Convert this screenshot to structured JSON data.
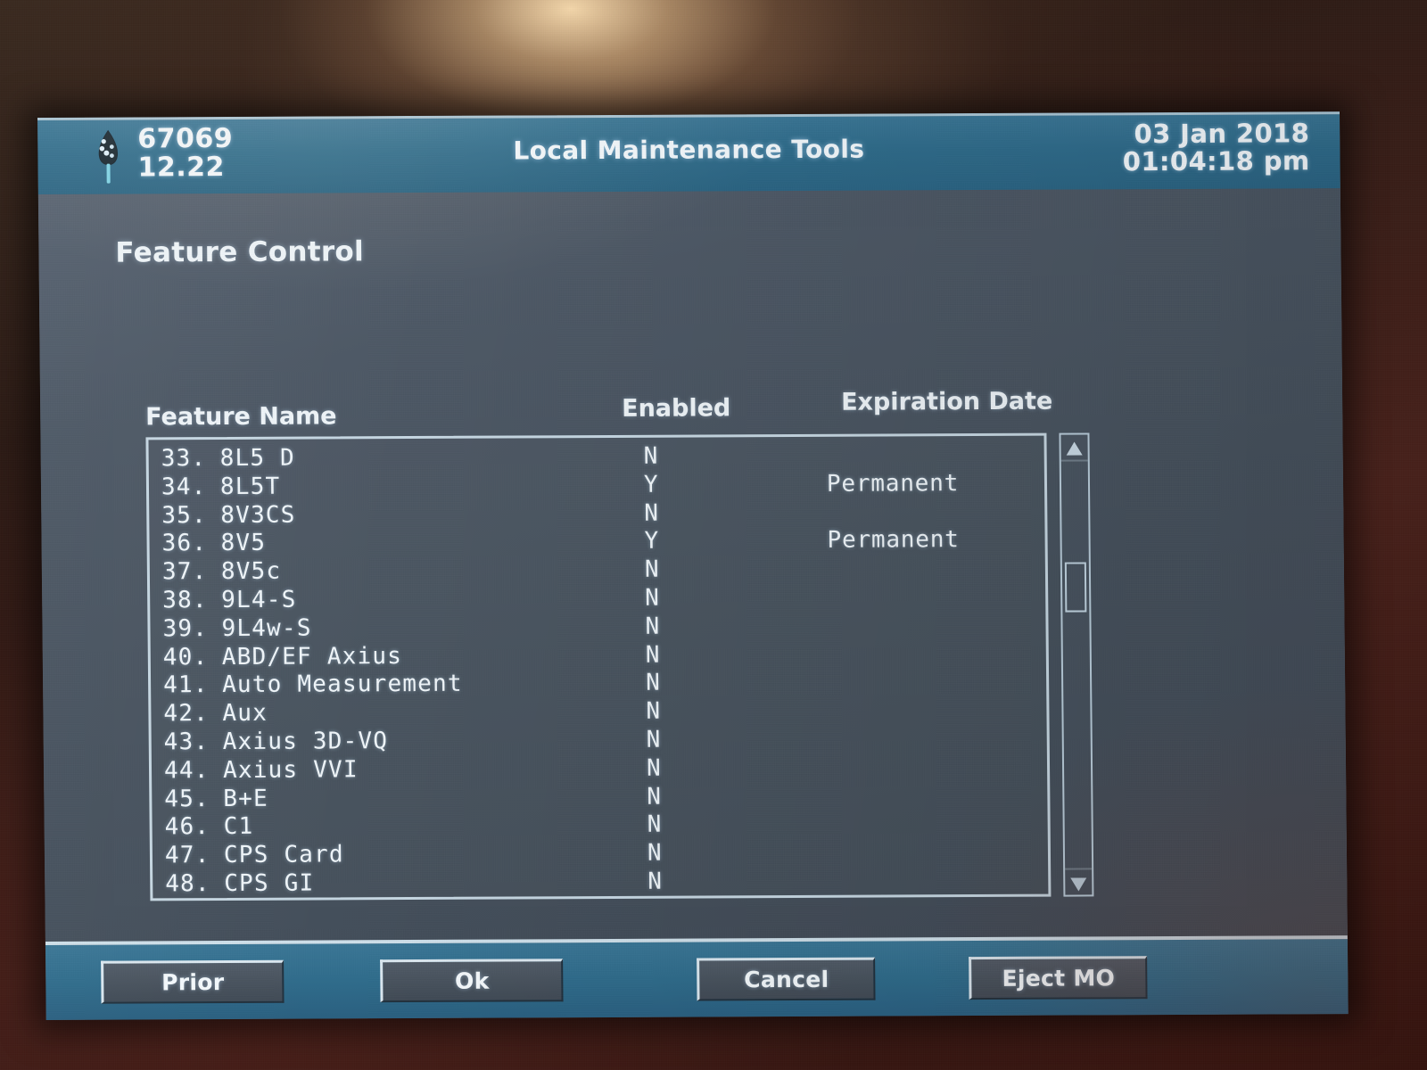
{
  "header": {
    "device_id": "67069",
    "version": "12.22",
    "title": "Local Maintenance Tools",
    "date": "03 Jan 2018",
    "time": "01:04:18 pm",
    "icon": "tree-icon"
  },
  "section": {
    "title": "Feature Control"
  },
  "table": {
    "columns": [
      "Feature Name",
      "Enabled",
      "Expiration Date"
    ],
    "rows": [
      {
        "index": "33.",
        "name": "8L5 D",
        "enabled": "N",
        "expiration": ""
      },
      {
        "index": "34.",
        "name": "8L5T",
        "enabled": "Y",
        "expiration": "Permanent"
      },
      {
        "index": "35.",
        "name": "8V3CS",
        "enabled": "N",
        "expiration": ""
      },
      {
        "index": "36.",
        "name": "8V5",
        "enabled": "Y",
        "expiration": "Permanent"
      },
      {
        "index": "37.",
        "name": "8V5c",
        "enabled": "N",
        "expiration": ""
      },
      {
        "index": "38.",
        "name": "9L4-S",
        "enabled": "N",
        "expiration": ""
      },
      {
        "index": "39.",
        "name": "9L4w-S",
        "enabled": "N",
        "expiration": ""
      },
      {
        "index": "40.",
        "name": "ABD/EF Axius",
        "enabled": "N",
        "expiration": ""
      },
      {
        "index": "41.",
        "name": "Auto Measurement",
        "enabled": "N",
        "expiration": ""
      },
      {
        "index": "42.",
        "name": "Aux",
        "enabled": "N",
        "expiration": ""
      },
      {
        "index": "43.",
        "name": "Axius 3D-VQ",
        "enabled": "N",
        "expiration": ""
      },
      {
        "index": "44.",
        "name": "Axius VVI",
        "enabled": "N",
        "expiration": ""
      },
      {
        "index": "45.",
        "name": "B+E",
        "enabled": "N",
        "expiration": ""
      },
      {
        "index": "46.",
        "name": "C1",
        "enabled": "N",
        "expiration": ""
      },
      {
        "index": "47.",
        "name": "CPS Card",
        "enabled": "N",
        "expiration": ""
      },
      {
        "index": "48.",
        "name": "CPS GI",
        "enabled": "N",
        "expiration": ""
      }
    ]
  },
  "scrollbar": {
    "up_icon": "triangle-up-icon",
    "down_icon": "triangle-down-icon"
  },
  "cursor": {
    "icon": "arrow-cursor",
    "color": "#3fe0d8"
  },
  "buttons": {
    "prior": "Prior",
    "ok": "Ok",
    "cancel": "Cancel",
    "eject": "Eject MO"
  },
  "colors": {
    "titlebar": "#2f6c8c",
    "screen_body": "#4b5560",
    "text": "#eff5f9",
    "border": "#c6d7e2",
    "backdrop": "#35140f"
  }
}
